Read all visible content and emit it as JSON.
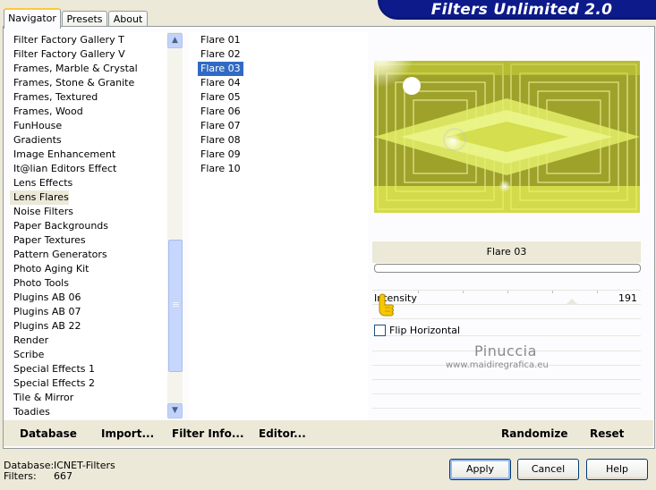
{
  "tabs": [
    "Navigator",
    "Presets",
    "About"
  ],
  "banner_title": "Filters Unlimited 2.0",
  "filter_categories": [
    "Filter Factory Gallery T",
    "Filter Factory Gallery V",
    "Frames, Marble & Crystal",
    "Frames, Stone & Granite",
    "Frames, Textured",
    "Frames, Wood",
    "FunHouse",
    "Gradients",
    "Image Enhancement",
    "It@lian Editors Effect",
    "Lens Effects",
    "Lens Flares",
    "Noise Filters",
    "Paper Backgrounds",
    "Paper Textures",
    "Pattern Generators",
    "Photo Aging Kit",
    "Photo Tools",
    "Plugins AB 06",
    "Plugins AB 07",
    "Plugins AB 22",
    "Render",
    "Scribe",
    "Special Effects 1",
    "Special Effects 2",
    "Tile & Mirror",
    "Toadies"
  ],
  "selected_category": "Lens Flares",
  "filters": [
    "Flare 01",
    "Flare 02",
    "Flare 03",
    "Flare 04",
    "Flare 05",
    "Flare 06",
    "Flare 07",
    "Flare 08",
    "Flare 09",
    "Flare 10"
  ],
  "selected_filter": "Flare 03",
  "preview": {
    "filter_name": "Flare 03",
    "intensity_label": "Intensity",
    "intensity_value": "191",
    "flip_label": "Flip Horizontal",
    "flip_checked": false
  },
  "watermark": {
    "name": "Pinuccia",
    "url": "www.maidiregrafica.eu"
  },
  "bottom_buttons": {
    "database": "Database",
    "import": "Import...",
    "filter_info": "Filter Info...",
    "editor": "Editor...",
    "randomize": "Randomize",
    "reset": "Reset"
  },
  "status": {
    "database_label": "Database:",
    "database_value": "ICNET-Filters",
    "filters_label": "Filters:",
    "filters_value": "667"
  },
  "dialog_buttons": {
    "apply": "Apply",
    "cancel": "Cancel",
    "help": "Help"
  },
  "colors": {
    "selection": "#316ac5",
    "banner": "#0d1a8a",
    "preview_yellow": "#d8e64a"
  }
}
